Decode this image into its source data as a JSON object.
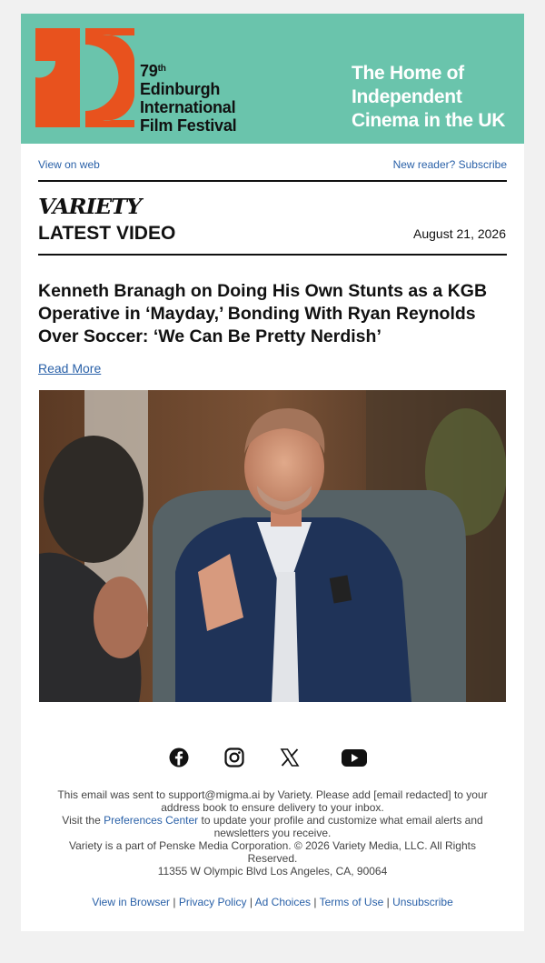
{
  "banner": {
    "edition": "79",
    "edition_suffix": "th",
    "fest_line1": "Edinburgh",
    "fest_line2": "International",
    "fest_line3": "Film Festival",
    "tagline_line1": "The Home of",
    "tagline_line2": "Independent",
    "tagline_line3": "Cinema in the UK",
    "brand_color": "#6ac4ac",
    "logo_color": "#e8521e"
  },
  "toplinks": {
    "view_on_web": "View on web",
    "subscribe": "New reader? Subscribe"
  },
  "header": {
    "logo_text": "VARIETY",
    "section_title": "LATEST VIDEO",
    "date": "August 21, 2026"
  },
  "article": {
    "headline": "Kenneth Branagh on Doing His Own Stunts as a KGB Operative in ‘Mayday,’ Bonding With Ryan Reynolds Over Soccer: ‘We Can Be Pretty Nerdish’",
    "read_more": "Read More"
  },
  "social": [
    "facebook-icon",
    "instagram-icon",
    "x-icon",
    "youtube-icon"
  ],
  "footer": {
    "line1": "This email was sent to support@migma.ai by Variety. Please add [email redacted] to your address book to ensure delivery to your inbox.",
    "line2_pre": "Visit the ",
    "line2_link": "Preferences Center",
    "line2_post": " to update your profile and customize what email alerts and newsletters you receive.",
    "line3": "Variety is a part of Penske Media Corporation. © 2026 Variety Media, LLC. All Rights Reserved.",
    "line4": "11355 W Olympic Blvd Los Angeles, CA, 90064",
    "links": [
      "View in Browser",
      "Privacy Policy",
      "Ad Choices",
      "Terms of Use",
      "Unsubscribe"
    ]
  }
}
